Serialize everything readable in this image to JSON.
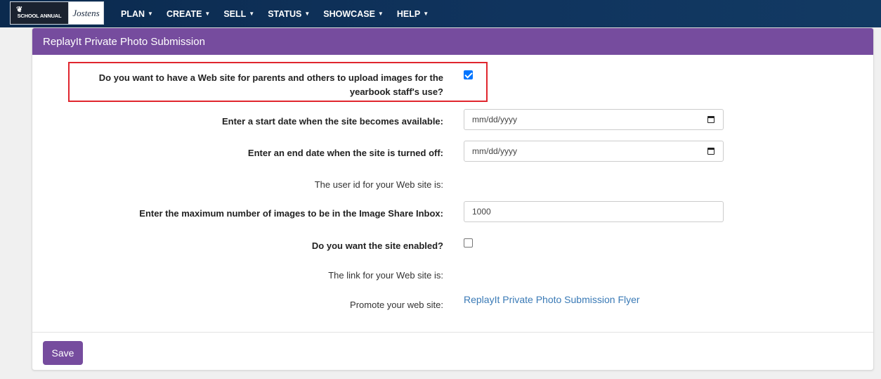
{
  "nav": {
    "logo_left": "SCHOOL ANNUAL",
    "logo_right": "Jostens",
    "items": [
      {
        "label": "PLAN"
      },
      {
        "label": "CREATE"
      },
      {
        "label": "SELL"
      },
      {
        "label": "STATUS"
      },
      {
        "label": "SHOWCASE"
      },
      {
        "label": "HELP"
      }
    ]
  },
  "panel": {
    "title": "ReplayIt Private Photo Submission"
  },
  "form": {
    "upload_question": "Do you want to have a Web site for parents and others to upload images for the yearbook staff's use?",
    "upload_checked": true,
    "start_date_label": "Enter a start date when the site becomes available:",
    "start_date_placeholder": "mm/dd/yyyy",
    "end_date_label": "Enter an end date when the site is turned off:",
    "end_date_placeholder": "mm/dd/yyyy",
    "user_id_label": "The user id for your Web site is:",
    "max_images_label": "Enter the maximum number of images to be in the Image Share Inbox:",
    "max_images_value": "1000",
    "enabled_label": "Do you want the site enabled?",
    "enabled_checked": false,
    "link_label": "The link for your Web site is:",
    "promote_label": "Promote your web site:",
    "promote_link": "ReplayIt Private Photo Submission Flyer"
  },
  "footer": {
    "save_label": "Save"
  },
  "colors": {
    "nav_bg": "#0b2a4e",
    "accent_purple": "#764c9e",
    "highlight_red": "#e0262e",
    "link_blue": "#3a7ab6",
    "checkbox_blue": "#0075ff"
  }
}
